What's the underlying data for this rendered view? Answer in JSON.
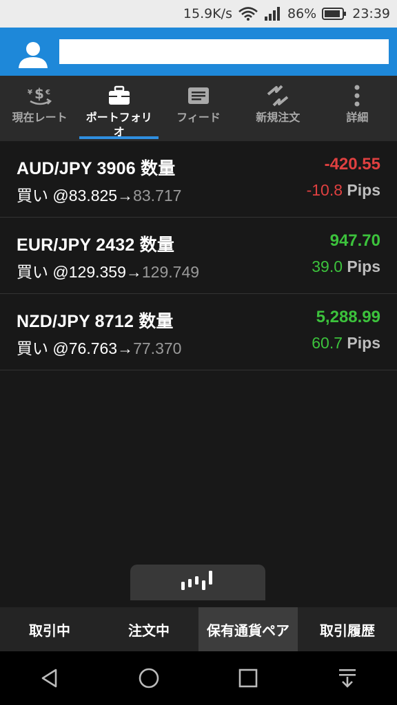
{
  "status_bar": {
    "net_speed": "15.9K/s",
    "battery": "86%",
    "time": "23:39"
  },
  "header": {
    "avatar_icon": "user-icon",
    "name_value": ""
  },
  "tabs": [
    {
      "label": "現在レート",
      "icon": "currency-exchange-icon",
      "active": false
    },
    {
      "label": "ポートフォリオ",
      "icon": "briefcase-icon",
      "active": true
    },
    {
      "label": "フィード",
      "icon": "feed-icon",
      "active": false
    },
    {
      "label": "新規注文",
      "icon": "new-order-icon",
      "active": false
    },
    {
      "label": "詳細",
      "icon": "more-vertical-icon",
      "active": false
    }
  ],
  "positions": [
    {
      "pair": "AUD/JPY 3906 数量",
      "side": "買い",
      "open_price": "@83.825→",
      "current_price": "83.717",
      "pl": "-420.55",
      "pips_value": "-10.8",
      "pips_unit": "Pips"
    },
    {
      "pair": "EUR/JPY 2432 数量",
      "side": "買い",
      "open_price": "@129.359→",
      "current_price": "129.749",
      "pl": "947.70",
      "pips_value": "39.0",
      "pips_unit": "Pips"
    },
    {
      "pair": "NZD/JPY 8712 数量",
      "side": "買い",
      "open_price": "@76.763→",
      "current_price": "77.370",
      "pl": "5,288.99",
      "pips_value": "60.7",
      "pips_unit": "Pips"
    }
  ],
  "bottom_tabs": [
    {
      "label": "取引中",
      "active": false
    },
    {
      "label": "注文中",
      "active": false
    },
    {
      "label": "保有通貨ペア",
      "active": true
    },
    {
      "label": "取引履歴",
      "active": false
    }
  ],
  "colors": {
    "header": "#1e88d9",
    "negative": "#e04040",
    "positive": "#3cc23c",
    "tab_underline": "#2f8fe0"
  }
}
